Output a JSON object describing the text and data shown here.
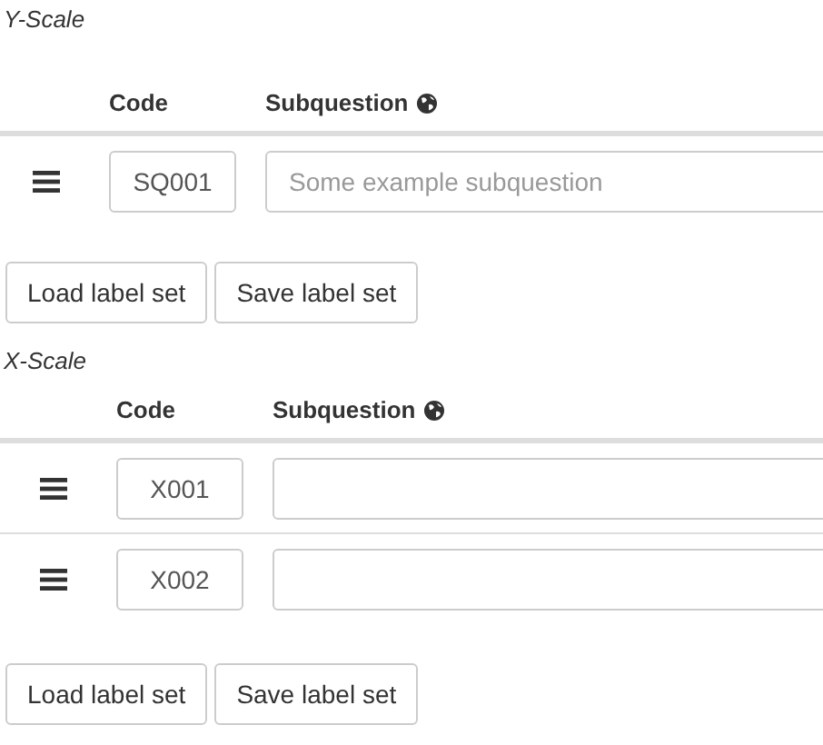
{
  "sections": [
    {
      "title": "Y-Scale",
      "columns": [
        "Code",
        "Subquestion"
      ],
      "rows": [
        {
          "code": "SQ001",
          "subquestion_placeholder": "Some example subquestion"
        }
      ],
      "buttons": [
        "Load label set",
        "Save label set"
      ]
    },
    {
      "title": "X-Scale",
      "columns": [
        "Code",
        "Subquestion"
      ],
      "rows": [
        {
          "code": "X001"
        },
        {
          "code": "X002"
        }
      ],
      "buttons": [
        "Load label set",
        "Save label set"
      ]
    }
  ]
}
